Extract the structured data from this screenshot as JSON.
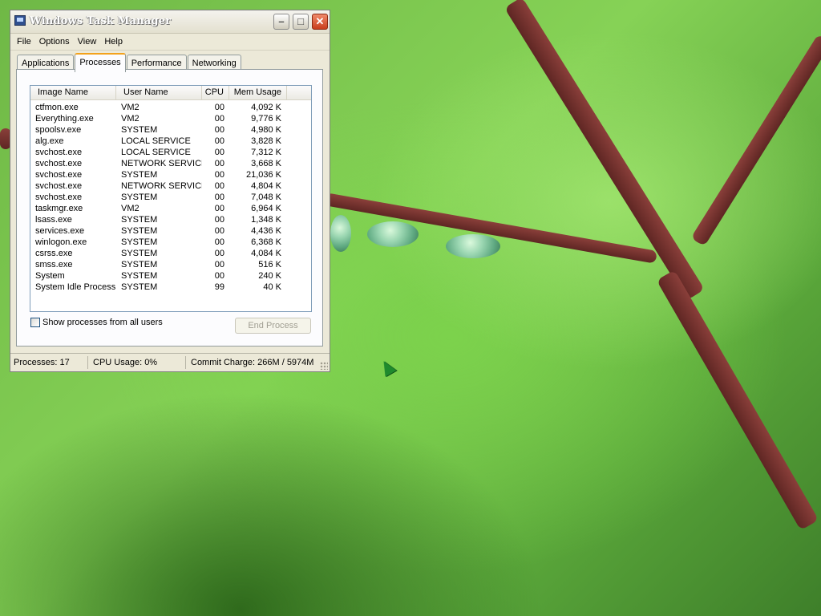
{
  "window": {
    "title": "Windows Task Manager",
    "buttons": {
      "minimize": "–",
      "maximize": "□",
      "close": "✕"
    }
  },
  "menu": [
    "File",
    "Options",
    "View",
    "Help"
  ],
  "tabs": [
    {
      "label": "Applications",
      "active": false
    },
    {
      "label": "Processes",
      "active": true
    },
    {
      "label": "Performance",
      "active": false
    },
    {
      "label": "Networking",
      "active": false
    }
  ],
  "table": {
    "columns": [
      "Image Name",
      "User Name",
      "CPU",
      "Mem Usage"
    ],
    "rows": [
      [
        "ctfmon.exe",
        "VM2",
        "00",
        "4,092 K"
      ],
      [
        "Everything.exe",
        "VM2",
        "00",
        "9,776 K"
      ],
      [
        "spoolsv.exe",
        "SYSTEM",
        "00",
        "4,980 K"
      ],
      [
        "alg.exe",
        "LOCAL SERVICE",
        "00",
        "3,828 K"
      ],
      [
        "svchost.exe",
        "LOCAL SERVICE",
        "00",
        "7,312 K"
      ],
      [
        "svchost.exe",
        "NETWORK SERVICE",
        "00",
        "3,668 K"
      ],
      [
        "svchost.exe",
        "SYSTEM",
        "00",
        "21,036 K"
      ],
      [
        "svchost.exe",
        "NETWORK SERVICE",
        "00",
        "4,804 K"
      ],
      [
        "svchost.exe",
        "SYSTEM",
        "00",
        "7,048 K"
      ],
      [
        "taskmgr.exe",
        "VM2",
        "00",
        "6,964 K"
      ],
      [
        "lsass.exe",
        "SYSTEM",
        "00",
        "1,348 K"
      ],
      [
        "services.exe",
        "SYSTEM",
        "00",
        "4,436 K"
      ],
      [
        "winlogon.exe",
        "SYSTEM",
        "00",
        "6,368 K"
      ],
      [
        "csrss.exe",
        "SYSTEM",
        "00",
        "4,084 K"
      ],
      [
        "smss.exe",
        "SYSTEM",
        "00",
        "516 K"
      ],
      [
        "System",
        "SYSTEM",
        "00",
        "240 K"
      ],
      [
        "System Idle Process",
        "SYSTEM",
        "99",
        "40 K"
      ]
    ]
  },
  "show_all_users": {
    "label": "Show processes from all users",
    "checked": false
  },
  "end_process_label": "End Process",
  "status": {
    "processes": "Processes: 17",
    "cpu": "CPU Usage: 0%",
    "commit": "Commit Charge: 266M / 5974M"
  },
  "colors": {
    "accent_tab": "#f3a21c",
    "close_button": "#c83e1c",
    "desktop": "#86d256"
  }
}
